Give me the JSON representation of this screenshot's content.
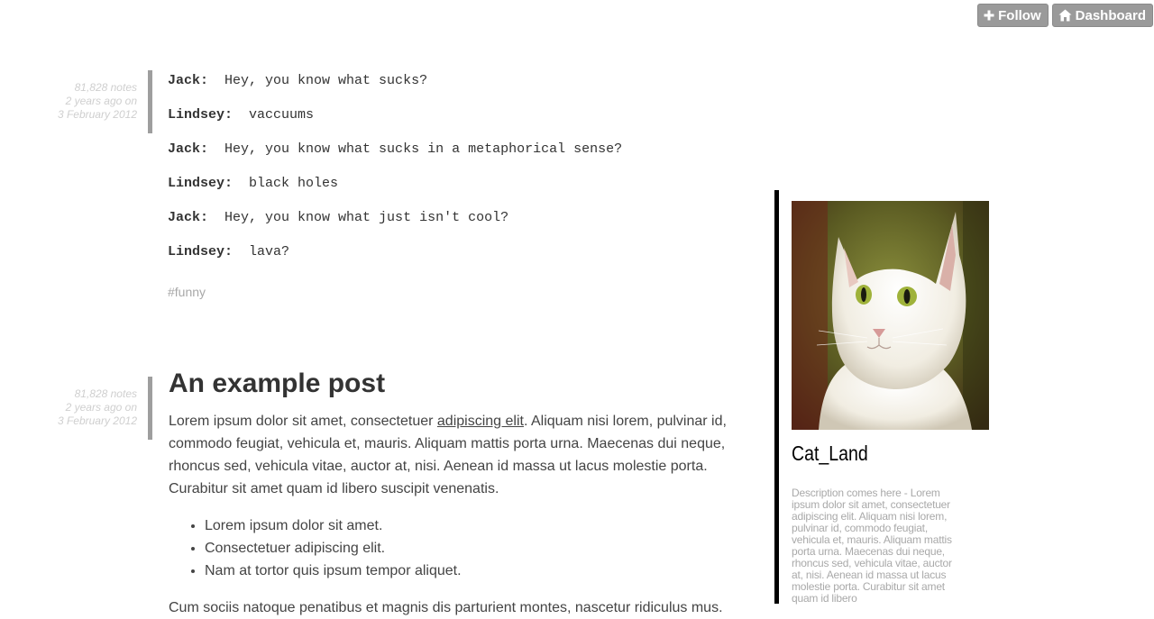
{
  "topbar": {
    "follow_label": "Follow",
    "dashboard_label": "Dashboard"
  },
  "posts": [
    {
      "notes": "81,828 notes",
      "ago": "2 years ago on",
      "date": "3 February 2012",
      "chat": [
        {
          "speaker": "Jack:",
          "text": "Hey, you know what sucks?"
        },
        {
          "speaker": "Lindsey:",
          "text": "vaccuums"
        },
        {
          "speaker": "Jack:",
          "text": "Hey, you know what sucks in a metaphorical sense?"
        },
        {
          "speaker": "Lindsey:",
          "text": "black holes"
        },
        {
          "speaker": "Jack:",
          "text": "Hey, you know what just isn't cool?"
        },
        {
          "speaker": "Lindsey:",
          "text": "lava?"
        }
      ],
      "tag": "#funny"
    },
    {
      "notes": "81,828 notes",
      "ago": "2 years ago on",
      "date": "3 February 2012",
      "title": "An example post",
      "para1_before": "Lorem ipsum dolor sit amet, consectetuer ",
      "para1_link": "adipiscing elit",
      "para1_after": ". Aliquam nisi lorem, pulvinar id, commodo feugiat, vehicula et, mauris. Aliquam mattis porta urna. Maecenas dui neque, rhoncus sed, vehicula vitae, auctor at, nisi. Aenean id massa ut lacus molestie porta. Curabitur sit amet quam id libero suscipit venenatis.",
      "list": [
        "Lorem ipsum dolor sit amet.",
        "Consectetuer adipiscing elit.",
        "Nam at tortor quis ipsum tempor aliquet."
      ],
      "para2": "Cum sociis natoque penatibus et magnis dis parturient montes, nascetur ridiculus mus."
    }
  ],
  "sidebar": {
    "blog_title": "Cat_Land",
    "description": "Description comes here - Lorem ipsum dolor sit amet, consectetuer adipiscing elit. Aliquam nisi lorem, pulvinar id, commodo feugiat, vehicula et, mauris. Aliquam mattis porta urna. Maecenas dui neque, rhoncus sed, vehicula vitae, auctor at, nisi. Aenean id massa ut lacus molestie porta. Curabitur sit amet quam id libero"
  },
  "colors": {
    "button_bg": "#9a9a9a",
    "meta_text": "#cfcfcf",
    "post_bar": "#9e9e9e",
    "sidebar_rule": "#000000"
  },
  "icons": {
    "follow": "plus-icon",
    "dashboard": "home-icon"
  }
}
